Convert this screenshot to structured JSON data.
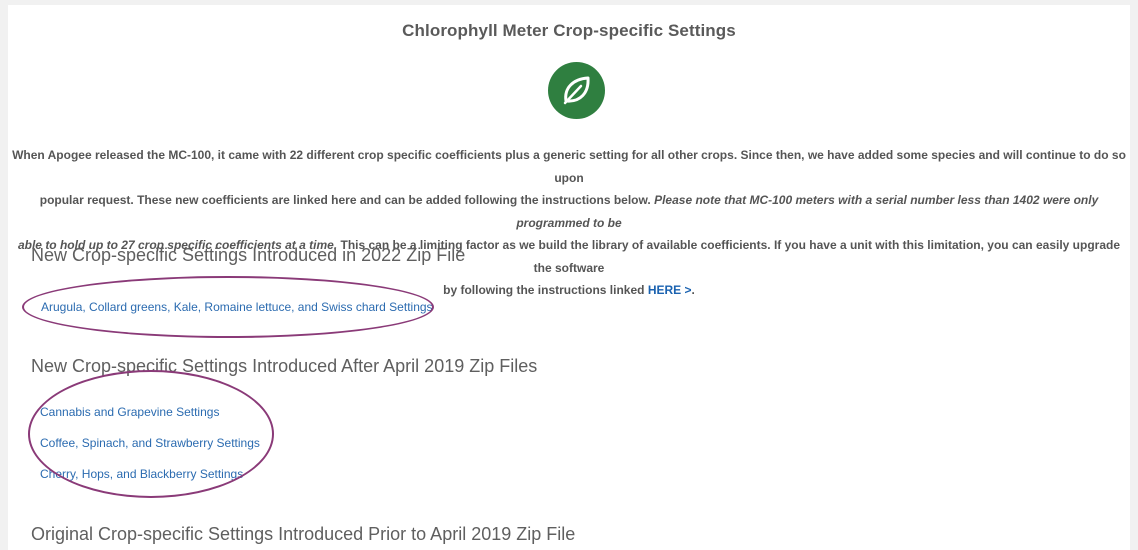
{
  "page": {
    "title": "Chlorophyll Meter Crop-specific Settings"
  },
  "logo": {
    "icon": "leaf-icon",
    "color": "#2f7f40"
  },
  "intro": {
    "line1": "When Apogee released the MC-100, it came with 22 different crop specific coefficients plus a generic setting for all other crops. Since then, we have added some species and will continue to do so upon",
    "line2_a": "popular request. These new coefficients are linked here and can be added following the instructions below.",
    "line2_b": "Please note that MC-100 meters with a serial number less than 1402 were only programmed to be",
    "line3_a": "able to hold up to 27 crop specific coefficients at a time.",
    "line3_b": "This can be a limiting factor as we build the library of available coefficients. If you have a unit with this limitation, you can easily upgrade the software",
    "line4": "by following the instructions linked",
    "here_link": "HERE >",
    "period": "."
  },
  "sections": [
    {
      "heading": "New Crop-specific Settings Introduced in 2022 Zip File",
      "links": [
        "Arugula, Collard greens, Kale, Romaine lettuce, and Swiss chard Settings"
      ]
    },
    {
      "heading": "New Crop-specific Settings Introduced After April 2019 Zip Files",
      "links": [
        "Cannabis and Grapevine Settings",
        "Coffee, Spinach, and Strawberry Settings",
        "Cherry, Hops, and Blackberry Settings"
      ]
    },
    {
      "heading": "Original Crop-specific Settings Introduced Prior to April 2019 Zip File",
      "links": []
    }
  ],
  "annotation_color": "#8a3a78"
}
